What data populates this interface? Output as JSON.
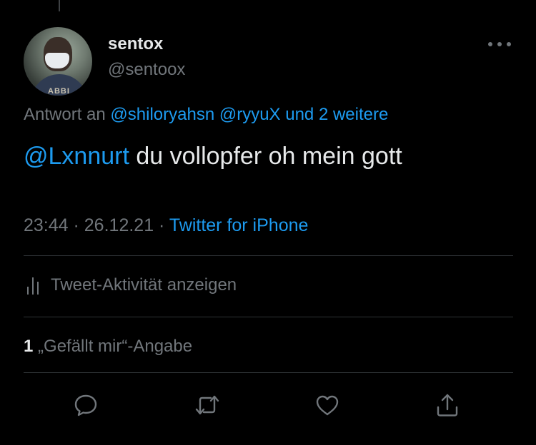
{
  "tweet": {
    "author": {
      "display_name": "sentox",
      "handle": "@sentoox",
      "avatar_shirt_text": "ABBI"
    },
    "reply_to": {
      "prefix": "Antwort an",
      "mention_1": "@shiloryahsn",
      "mention_2": "@ryyuX",
      "more": "und 2 weitere"
    },
    "body": {
      "mention": "@Lxnnurt",
      "text": " du vollopfer oh mein gott"
    },
    "meta": {
      "time": "23:44",
      "separator_1": " · ",
      "date": "26.12.21",
      "separator_2": " · ",
      "source": "Twitter for iPhone"
    },
    "activity_label": "Tweet-Aktivität anzeigen",
    "likes": {
      "count": "1",
      "label": " „Gefällt mir“-Angabe"
    }
  },
  "icons": {
    "more": "more-horizontal-icon",
    "activity": "analytics-bars-icon",
    "reply": "reply-bubble-icon",
    "retweet": "retweet-icon",
    "like": "heart-icon",
    "share": "share-upload-icon"
  },
  "colors": {
    "background": "#000000",
    "text_primary": "#e7e9ea",
    "text_secondary": "#71767b",
    "link": "#1d9bf0",
    "divider": "#2f3336"
  }
}
